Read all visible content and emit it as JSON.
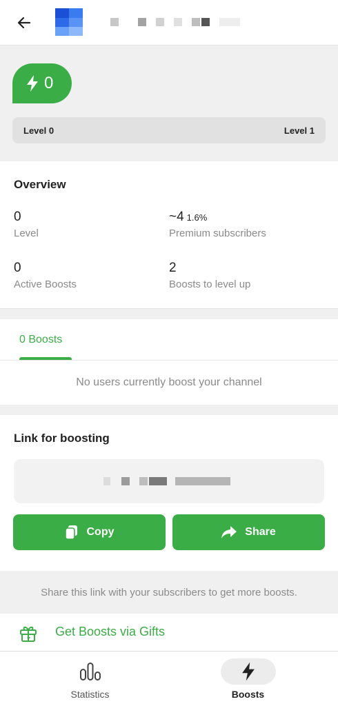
{
  "header": {
    "back_icon": "arrow-left-icon",
    "channel_avatar": "channel-avatar-pixelated",
    "channel_name_redacted": true
  },
  "level_panel": {
    "bubble_value": "0",
    "bubble_icon": "lightning-bolt-icon",
    "level_start": "Level 0",
    "level_end": "Level 1",
    "progress": 0
  },
  "overview": {
    "title": "Overview",
    "level_value": "0",
    "level_label": "Level",
    "premium_value": "~4",
    "premium_percent": "1.6%",
    "premium_label": "Premium subscribers",
    "active_value": "0",
    "active_label": "Active Boosts",
    "levelup_value": "2",
    "levelup_label": "Boosts to level up"
  },
  "boosts": {
    "tab_label": "0 Boosts",
    "empty_text": "No users currently boost your channel"
  },
  "link_section": {
    "title": "Link for boosting",
    "link_redacted": true,
    "copy_label": "Copy",
    "copy_icon": "copy-icon",
    "share_label": "Share",
    "share_icon": "share-arrow-icon",
    "hint": "Share this link with your subscribers to get more boosts."
  },
  "gifts": {
    "label": "Get Boosts via Gifts",
    "icon": "gift-icon"
  },
  "bottom_nav": {
    "items": [
      {
        "label": "Statistics",
        "icon": "bar-chart-icon",
        "active": false
      },
      {
        "label": "Boosts",
        "icon": "lightning-bolt-icon",
        "active": true
      }
    ]
  },
  "colors": {
    "accent": "#3bad46",
    "panel_bg": "#f0f0f0",
    "muted_text": "#8a8a8a"
  }
}
